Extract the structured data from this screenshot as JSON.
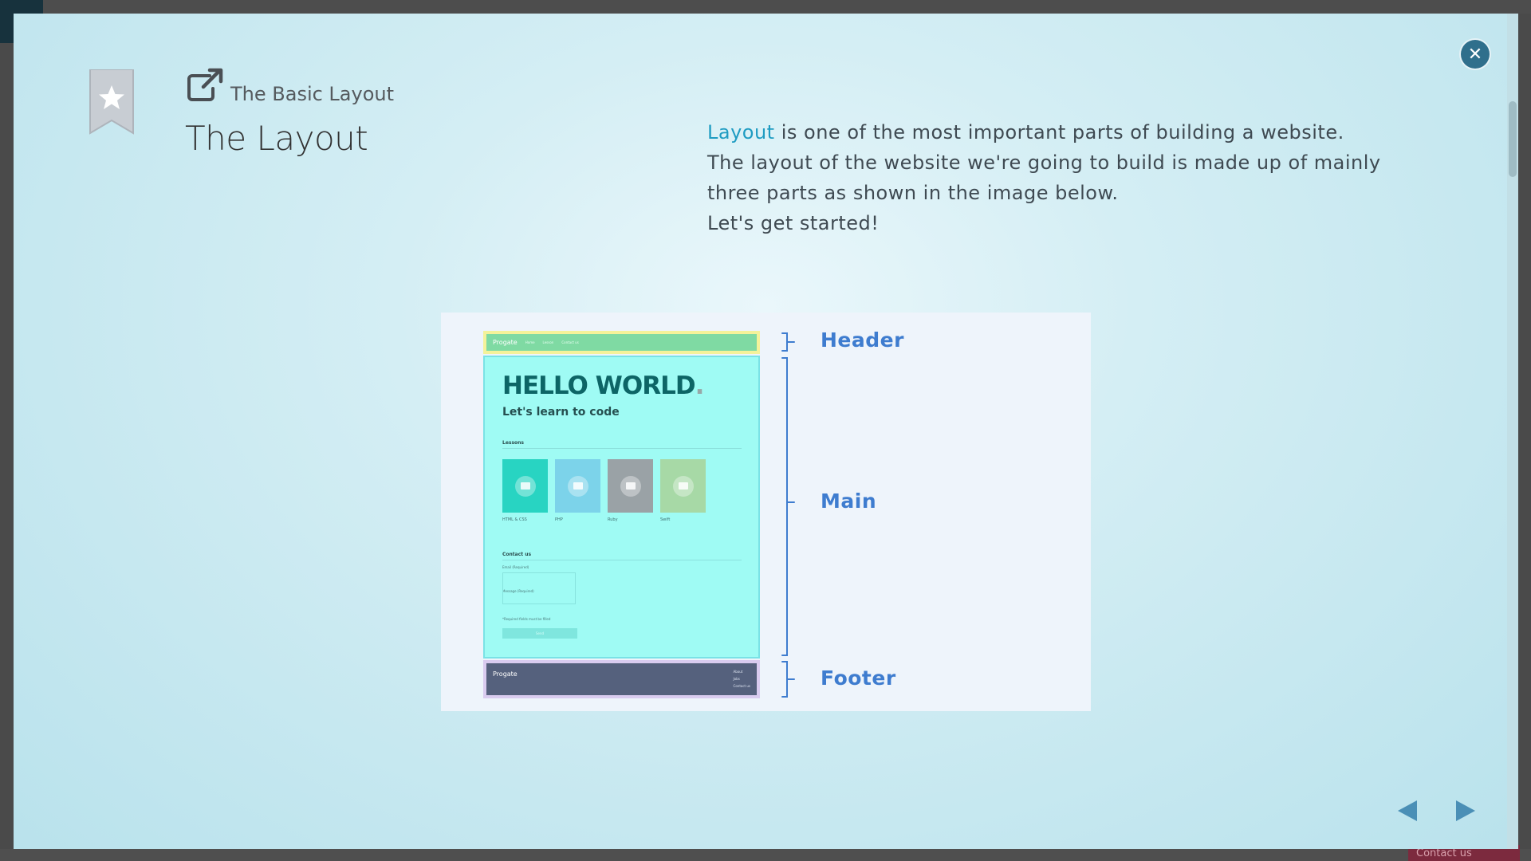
{
  "background": {
    "contact_label": "Contact us"
  },
  "modal": {
    "breadcrumb": "The Basic Layout",
    "title": "The Layout",
    "description": {
      "link_text": "Layout",
      "line1_rest": " is one of the most important parts of building a website.",
      "line2": "The layout of the website we're going to build is made up of mainly",
      "line3": "three parts as shown in the image below.",
      "line4": "Let's get started!"
    },
    "icons": {
      "bookmark": "bookmark-star-icon",
      "external": "external-link-icon",
      "close": "close-icon",
      "prev": "previous-arrow-icon",
      "next": "next-arrow-icon"
    }
  },
  "diagram": {
    "labels": {
      "header": "Header",
      "main": "Main",
      "footer": "Footer"
    },
    "mockup": {
      "brand": "Progate",
      "nav_items": [
        "Home",
        "Lesson",
        "Contact us"
      ],
      "hero_title": "HELLO WORLD",
      "hero_dot": ".",
      "subtitle": "Let's learn to code",
      "lessons_heading": "Lessons",
      "lessons": [
        {
          "name": "HTML & CSS",
          "color": "#28d4c2"
        },
        {
          "name": "PHP",
          "color": "#7cd3ea"
        },
        {
          "name": "Ruby",
          "color": "#9aa2a6"
        },
        {
          "name": "Swift",
          "color": "#a7d9a6"
        }
      ],
      "contact_heading": "Contact us",
      "email_label": "Email (Required)",
      "message_label": "Message (Required)",
      "required_note": "*Required fields must be filled",
      "send_label": "Send",
      "footer_brand": "Progate",
      "footer_links": [
        "About",
        "Jobs",
        "Contact us"
      ]
    },
    "colors": {
      "label": "#3e7ccf",
      "header_frame": "#f4f29a",
      "main_bg": "#9ffbf4",
      "footer_frame": "#d9cbef",
      "footer_bg": "#55617d"
    }
  }
}
